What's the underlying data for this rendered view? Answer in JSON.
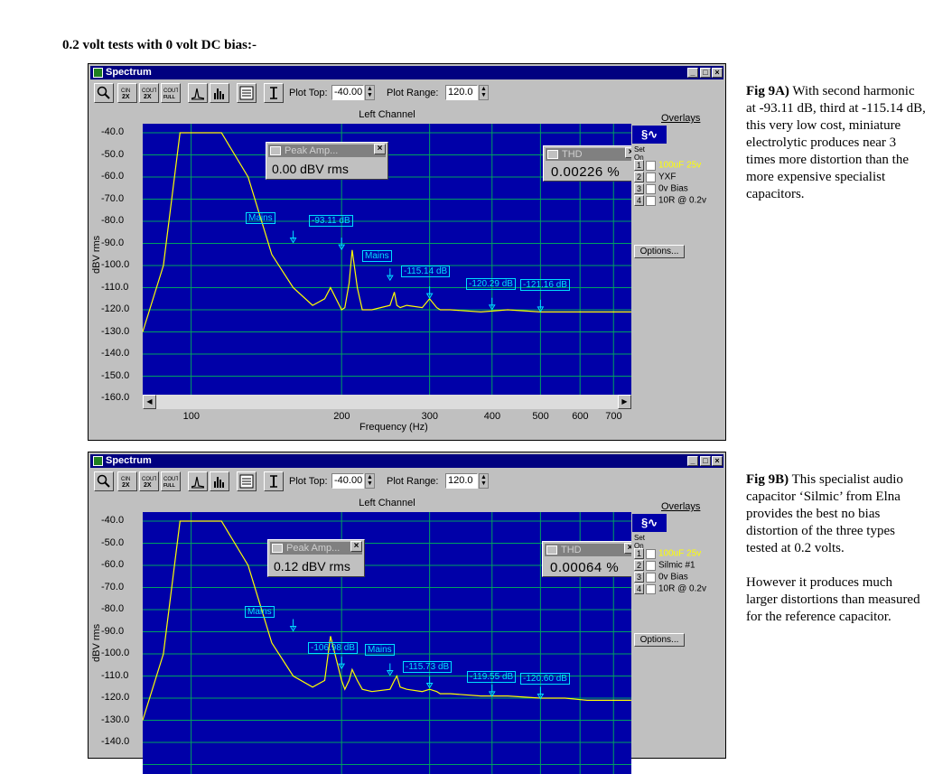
{
  "heading": "0.2 volt tests with 0 volt DC bias:-",
  "windows": [
    {
      "title": "Spectrum",
      "toolbar": {
        "plot_top_label": "Plot Top:",
        "plot_top_value": "-40.00",
        "plot_range_label": "Plot Range:",
        "plot_range_value": "120.0"
      },
      "channel_title": "Left Channel",
      "ylabel": "dBV rms",
      "xlabel": "Frequency (Hz)",
      "yticks": [
        "-40.0",
        "-50.0",
        "-60.0",
        "-70.0",
        "-80.0",
        "-90.0",
        "-100.0",
        "-110.0",
        "-120.0",
        "-130.0",
        "-140.0",
        "-150.0",
        "-160.0"
      ],
      "xticks": [
        "100",
        "200",
        "300",
        "400",
        "500",
        "600",
        "700"
      ],
      "peak_amp": {
        "title": "Peak Amp...",
        "value": "0.00 dBV rms"
      },
      "thd": {
        "title": "THD",
        "value": "0.00226 %"
      },
      "annotations": [
        "Mains",
        "-93.11 dB",
        "Mains",
        "-115.14 dB",
        "-120.29 dB",
        "-121.16 dB"
      ],
      "overlays": {
        "title": "Overlays",
        "set_label": "Set",
        "on_label": "On",
        "items": [
          {
            "num": "1",
            "label": "100uF 25v",
            "color": "#ffff00"
          },
          {
            "num": "2",
            "label": "YXF",
            "color": "#000000"
          },
          {
            "num": "3",
            "label": "0v Bias",
            "color": "#000000"
          },
          {
            "num": "4",
            "label": "10R @ 0.2v",
            "color": "#000000"
          }
        ],
        "options_label": "Options..."
      }
    },
    {
      "title": "Spectrum",
      "toolbar": {
        "plot_top_label": "Plot Top:",
        "plot_top_value": "-40.00",
        "plot_range_label": "Plot Range:",
        "plot_range_value": "120.0"
      },
      "channel_title": "Left Channel",
      "ylabel": "dBV rms",
      "yticks": [
        "-40.0",
        "-50.0",
        "-60.0",
        "-70.0",
        "-80.0",
        "-90.0",
        "-100.0",
        "-110.0",
        "-120.0",
        "-130.0",
        "-140.0"
      ],
      "peak_amp": {
        "title": "Peak Amp...",
        "value": "0.12 dBV rms"
      },
      "thd": {
        "title": "THD",
        "value": "0.00064 %"
      },
      "annotations": [
        "Mains",
        "-106.98 dB",
        "Mains",
        "-115.73 dB",
        "-119.55 dB",
        "-120.60 dB"
      ],
      "overlays": {
        "title": "Overlays",
        "set_label": "Set",
        "on_label": "On",
        "items": [
          {
            "num": "1",
            "label": "100uF 25v",
            "color": "#ffff00"
          },
          {
            "num": "2",
            "label": "Silmic #1",
            "color": "#000000"
          },
          {
            "num": "3",
            "label": "0v Bias",
            "color": "#000000"
          },
          {
            "num": "4",
            "label": "10R @ 0.2v",
            "color": "#000000"
          }
        ],
        "options_label": "Options..."
      }
    }
  ],
  "captions": [
    {
      "label": "Fig 9A)",
      "text": "With second harmonic at -93.11 dB, third at -115.14 dB, this very low cost, miniature electrolytic produces near 3 times more distortion than the more expensive specialist capacitors."
    },
    {
      "label": "Fig 9B)",
      "text": "This specialist audio capacitor ‘Silmic’ from Elna provides the best no bias distortion of the three types tested at 0.2 volts.",
      "text2": "However it produces much larger distortions than measured for the reference capacitor."
    }
  ],
  "chart_data": [
    {
      "type": "line",
      "title": "Left Channel",
      "xlabel": "Frequency (Hz)",
      "ylabel": "dBV rms",
      "xscale": "log",
      "xlim": [
        80,
        760
      ],
      "ylim": [
        -160,
        -40
      ],
      "grid": true,
      "series": [
        {
          "name": "100uF 25v",
          "color": "#ffff00",
          "x": [
            80,
            88,
            95,
            105,
            115,
            130,
            145,
            160,
            175,
            185,
            190,
            200,
            203,
            207,
            210,
            215,
            220,
            230,
            250,
            255,
            258,
            262,
            270,
            290,
            300,
            310,
            315,
            330,
            380,
            430,
            500,
            560,
            620,
            700,
            760
          ],
          "y": [
            -130,
            -100,
            -40,
            -40,
            -40,
            -60,
            -95,
            -110,
            -118,
            -115,
            -110,
            -120,
            -119,
            -108,
            -93,
            -110,
            -120,
            -120,
            -118,
            -112,
            -118,
            -119,
            -118,
            -119,
            -115,
            -119,
            -120,
            -120,
            -121,
            -120,
            -121,
            -121,
            -121,
            -121,
            -121
          ]
        }
      ],
      "annotations": [
        {
          "x": 160,
          "y": -90,
          "text": "Mains"
        },
        {
          "x": 200,
          "y": -93.11,
          "text": "-93.11 dB"
        },
        {
          "x": 250,
          "y": -107,
          "text": "Mains"
        },
        {
          "x": 300,
          "y": -115.14,
          "text": "-115.14 dB"
        },
        {
          "x": 400,
          "y": -120.29,
          "text": "-120.29 dB"
        },
        {
          "x": 500,
          "y": -121.16,
          "text": "-121.16 dB"
        }
      ]
    },
    {
      "type": "line",
      "title": "Left Channel",
      "ylabel": "dBV rms",
      "xscale": "log",
      "xlim": [
        80,
        760
      ],
      "ylim": [
        -160,
        -40
      ],
      "grid": true,
      "series": [
        {
          "name": "100uF 25v",
          "color": "#ffff00",
          "x": [
            80,
            88,
            95,
            105,
            115,
            130,
            145,
            160,
            175,
            185,
            190,
            200,
            203,
            207,
            210,
            215,
            220,
            230,
            250,
            255,
            258,
            262,
            270,
            290,
            300,
            310,
            315,
            330,
            380,
            430,
            500,
            560,
            620,
            700,
            760
          ],
          "y": [
            -130,
            -100,
            -40,
            -40,
            -40,
            -60,
            -95,
            -110,
            -115,
            -112,
            -92,
            -112,
            -116,
            -112,
            -107,
            -112,
            -116,
            -117,
            -116,
            -112,
            -110,
            -115,
            -116,
            -117,
            -116,
            -117,
            -118,
            -118,
            -119,
            -119,
            -120,
            -120,
            -121,
            -121,
            -121
          ]
        }
      ],
      "annotations": [
        {
          "x": 160,
          "y": -90,
          "text": "Mains"
        },
        {
          "x": 200,
          "y": -106.98,
          "text": "-106.98 dB"
        },
        {
          "x": 250,
          "y": -110,
          "text": "Mains"
        },
        {
          "x": 300,
          "y": -115.73,
          "text": "-115.73 dB"
        },
        {
          "x": 400,
          "y": -119.55,
          "text": "-119.55 dB"
        },
        {
          "x": 500,
          "y": -120.6,
          "text": "-120.60 dB"
        }
      ]
    }
  ]
}
